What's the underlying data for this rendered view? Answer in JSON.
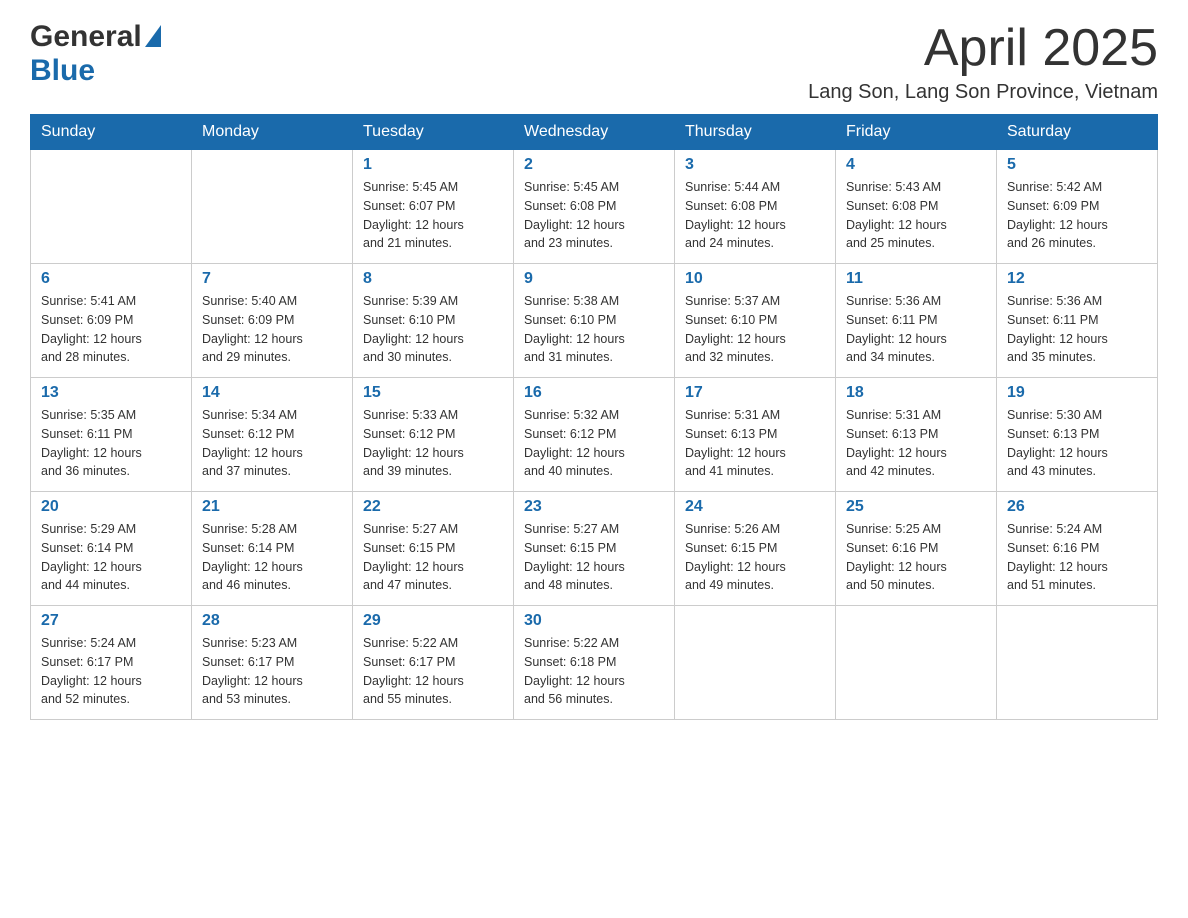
{
  "header": {
    "logo": {
      "general": "General",
      "blue": "Blue"
    },
    "month": "April 2025",
    "location": "Lang Son, Lang Son Province, Vietnam"
  },
  "weekdays": [
    "Sunday",
    "Monday",
    "Tuesday",
    "Wednesday",
    "Thursday",
    "Friday",
    "Saturday"
  ],
  "weeks": [
    [
      {
        "day": "",
        "info": ""
      },
      {
        "day": "",
        "info": ""
      },
      {
        "day": "1",
        "info": "Sunrise: 5:45 AM\nSunset: 6:07 PM\nDaylight: 12 hours\nand 21 minutes."
      },
      {
        "day": "2",
        "info": "Sunrise: 5:45 AM\nSunset: 6:08 PM\nDaylight: 12 hours\nand 23 minutes."
      },
      {
        "day": "3",
        "info": "Sunrise: 5:44 AM\nSunset: 6:08 PM\nDaylight: 12 hours\nand 24 minutes."
      },
      {
        "day": "4",
        "info": "Sunrise: 5:43 AM\nSunset: 6:08 PM\nDaylight: 12 hours\nand 25 minutes."
      },
      {
        "day": "5",
        "info": "Sunrise: 5:42 AM\nSunset: 6:09 PM\nDaylight: 12 hours\nand 26 minutes."
      }
    ],
    [
      {
        "day": "6",
        "info": "Sunrise: 5:41 AM\nSunset: 6:09 PM\nDaylight: 12 hours\nand 28 minutes."
      },
      {
        "day": "7",
        "info": "Sunrise: 5:40 AM\nSunset: 6:09 PM\nDaylight: 12 hours\nand 29 minutes."
      },
      {
        "day": "8",
        "info": "Sunrise: 5:39 AM\nSunset: 6:10 PM\nDaylight: 12 hours\nand 30 minutes."
      },
      {
        "day": "9",
        "info": "Sunrise: 5:38 AM\nSunset: 6:10 PM\nDaylight: 12 hours\nand 31 minutes."
      },
      {
        "day": "10",
        "info": "Sunrise: 5:37 AM\nSunset: 6:10 PM\nDaylight: 12 hours\nand 32 minutes."
      },
      {
        "day": "11",
        "info": "Sunrise: 5:36 AM\nSunset: 6:11 PM\nDaylight: 12 hours\nand 34 minutes."
      },
      {
        "day": "12",
        "info": "Sunrise: 5:36 AM\nSunset: 6:11 PM\nDaylight: 12 hours\nand 35 minutes."
      }
    ],
    [
      {
        "day": "13",
        "info": "Sunrise: 5:35 AM\nSunset: 6:11 PM\nDaylight: 12 hours\nand 36 minutes."
      },
      {
        "day": "14",
        "info": "Sunrise: 5:34 AM\nSunset: 6:12 PM\nDaylight: 12 hours\nand 37 minutes."
      },
      {
        "day": "15",
        "info": "Sunrise: 5:33 AM\nSunset: 6:12 PM\nDaylight: 12 hours\nand 39 minutes."
      },
      {
        "day": "16",
        "info": "Sunrise: 5:32 AM\nSunset: 6:12 PM\nDaylight: 12 hours\nand 40 minutes."
      },
      {
        "day": "17",
        "info": "Sunrise: 5:31 AM\nSunset: 6:13 PM\nDaylight: 12 hours\nand 41 minutes."
      },
      {
        "day": "18",
        "info": "Sunrise: 5:31 AM\nSunset: 6:13 PM\nDaylight: 12 hours\nand 42 minutes."
      },
      {
        "day": "19",
        "info": "Sunrise: 5:30 AM\nSunset: 6:13 PM\nDaylight: 12 hours\nand 43 minutes."
      }
    ],
    [
      {
        "day": "20",
        "info": "Sunrise: 5:29 AM\nSunset: 6:14 PM\nDaylight: 12 hours\nand 44 minutes."
      },
      {
        "day": "21",
        "info": "Sunrise: 5:28 AM\nSunset: 6:14 PM\nDaylight: 12 hours\nand 46 minutes."
      },
      {
        "day": "22",
        "info": "Sunrise: 5:27 AM\nSunset: 6:15 PM\nDaylight: 12 hours\nand 47 minutes."
      },
      {
        "day": "23",
        "info": "Sunrise: 5:27 AM\nSunset: 6:15 PM\nDaylight: 12 hours\nand 48 minutes."
      },
      {
        "day": "24",
        "info": "Sunrise: 5:26 AM\nSunset: 6:15 PM\nDaylight: 12 hours\nand 49 minutes."
      },
      {
        "day": "25",
        "info": "Sunrise: 5:25 AM\nSunset: 6:16 PM\nDaylight: 12 hours\nand 50 minutes."
      },
      {
        "day": "26",
        "info": "Sunrise: 5:24 AM\nSunset: 6:16 PM\nDaylight: 12 hours\nand 51 minutes."
      }
    ],
    [
      {
        "day": "27",
        "info": "Sunrise: 5:24 AM\nSunset: 6:17 PM\nDaylight: 12 hours\nand 52 minutes."
      },
      {
        "day": "28",
        "info": "Sunrise: 5:23 AM\nSunset: 6:17 PM\nDaylight: 12 hours\nand 53 minutes."
      },
      {
        "day": "29",
        "info": "Sunrise: 5:22 AM\nSunset: 6:17 PM\nDaylight: 12 hours\nand 55 minutes."
      },
      {
        "day": "30",
        "info": "Sunrise: 5:22 AM\nSunset: 6:18 PM\nDaylight: 12 hours\nand 56 minutes."
      },
      {
        "day": "",
        "info": ""
      },
      {
        "day": "",
        "info": ""
      },
      {
        "day": "",
        "info": ""
      }
    ]
  ]
}
